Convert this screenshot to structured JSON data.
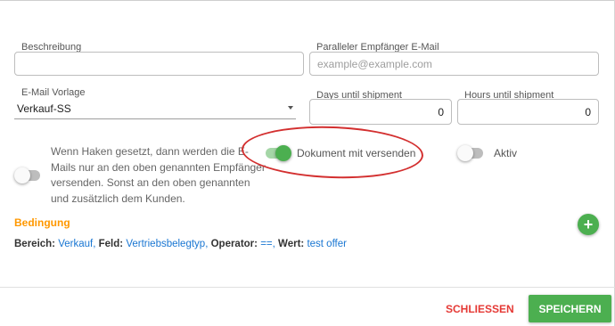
{
  "form": {
    "description": {
      "label": "Beschreibung",
      "value": "",
      "placeholder": ""
    },
    "parallel_email": {
      "label": "Paralleler Empfänger E-Mail",
      "value": "",
      "placeholder": "example@example.com"
    },
    "email_template": {
      "label": "E-Mail Vorlage",
      "selected": "Verkauf-SS"
    },
    "days_until_shipment": {
      "label": "Days until shipment",
      "value": "0"
    },
    "hours_until_shipment": {
      "label": "Hours until shipment",
      "value": "0"
    }
  },
  "toggles": {
    "only_named_recipients": {
      "state": "off",
      "help_lines": [
        "Wenn Haken gesetzt, dann werden die E-",
        "Mails nur an den oben genannten Empfänger",
        "versenden. Sonst an den oben genannten",
        "und zusätzlich dem Kunden."
      ]
    },
    "send_document": {
      "state": "on",
      "label": "Dokument mit versenden"
    },
    "active": {
      "state": "off",
      "label": "Aktiv"
    }
  },
  "condition": {
    "title": "Bedingung",
    "add_symbol": "+",
    "rows": [
      {
        "area_key": "Bereich:",
        "area_value": "Verkauf,",
        "field_key": "Feld:",
        "field_value": "Vertriebsbelegtyp,",
        "operator_key": "Operator:",
        "operator_value": "==,",
        "value_key": "Wert:",
        "value_value": "test offer"
      }
    ]
  },
  "footer": {
    "close_label": "SCHLIESSEN",
    "save_label": "SPEICHERN"
  },
  "colors": {
    "accent_green": "#4caf50",
    "section_orange": "#ff9800",
    "close_red": "#e53935",
    "link_blue": "#1976d2",
    "annotation_red": "#d32f2f"
  }
}
